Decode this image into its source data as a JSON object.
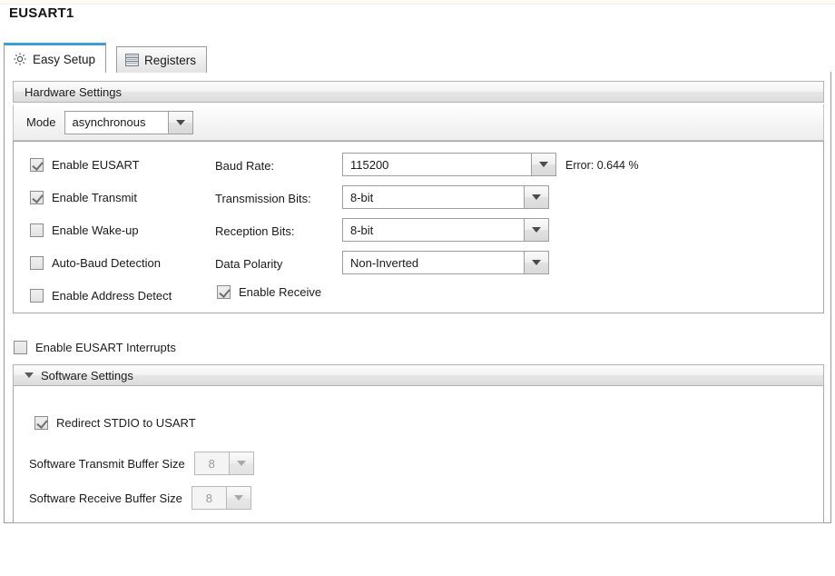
{
  "window": {
    "title": "EUSART1"
  },
  "tabs": [
    {
      "label": "Easy Setup",
      "icon": "gear-icon",
      "active": true
    },
    {
      "label": "Registers",
      "icon": "registers-table-icon",
      "active": false
    }
  ],
  "hardware": {
    "section_title": "Hardware Settings",
    "mode": {
      "label": "Mode",
      "value": "asynchronous"
    },
    "checkboxes": [
      {
        "label": "Enable EUSART",
        "checked": true
      },
      {
        "label": "Enable Transmit",
        "checked": true
      },
      {
        "label": "Enable Wake-up",
        "checked": false
      },
      {
        "label": "Auto-Baud Detection",
        "checked": false
      },
      {
        "label": "Enable Address Detect",
        "checked": false
      }
    ],
    "fields": [
      {
        "label": "Baud Rate:",
        "value": "115200"
      },
      {
        "label": "Transmission Bits:",
        "value": "8-bit"
      },
      {
        "label": "Reception Bits:",
        "value": "8-bit"
      },
      {
        "label": "Data Polarity",
        "value": "Non-Inverted"
      }
    ],
    "error_text": "Error: 0.644 %",
    "enable_receive": {
      "label": "Enable Receive",
      "checked": true
    }
  },
  "interrupts": {
    "label": "Enable EUSART Interrupts",
    "checked": false
  },
  "software": {
    "section_title": "Software Settings",
    "expanded": true,
    "redirect_stdio": {
      "label": "Redirect STDIO to USART",
      "checked": true
    },
    "transmit_buffer": {
      "label": "Software Transmit Buffer Size",
      "value": "8"
    },
    "receive_buffer": {
      "label": "Software Receive Buffer Size",
      "value": "8"
    }
  },
  "theme": {
    "active_tab_accent": "#3d9fd6",
    "panel_border": "#9a9a9a",
    "text": "#1d1d1d"
  }
}
